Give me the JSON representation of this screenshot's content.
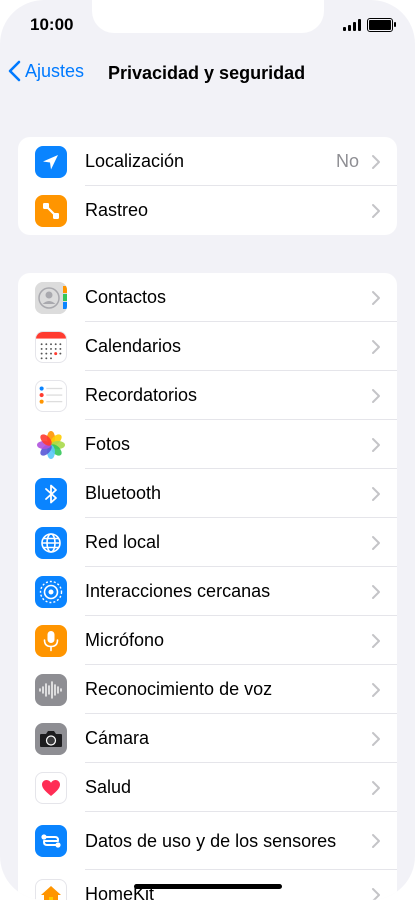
{
  "status_bar": {
    "time": "10:00"
  },
  "nav": {
    "back_label": "Ajustes",
    "title": "Privacidad y seguridad"
  },
  "group1": [
    {
      "name": "localizacion",
      "label": "Localización",
      "value": "No",
      "icon": "location-arrow-icon",
      "color": "#0a84ff"
    },
    {
      "name": "rastreo",
      "label": "Rastreo",
      "value": "",
      "icon": "tracking-icon",
      "color": "#ff9500"
    }
  ],
  "group2": [
    {
      "name": "contactos",
      "label": "Contactos",
      "icon": "contacts-icon"
    },
    {
      "name": "calendarios",
      "label": "Calendarios",
      "icon": "calendar-icon"
    },
    {
      "name": "recordatorios",
      "label": "Recordatorios",
      "icon": "reminders-icon"
    },
    {
      "name": "fotos",
      "label": "Fotos",
      "icon": "photos-icon"
    },
    {
      "name": "bluetooth",
      "label": "Bluetooth",
      "icon": "bluetooth-icon",
      "color": "#0a84ff"
    },
    {
      "name": "red-local",
      "label": "Red local",
      "icon": "globe-icon",
      "color": "#0a84ff"
    },
    {
      "name": "interacciones-cercanas",
      "label": "Interacciones cercanas",
      "icon": "nearby-interactions-icon",
      "color": "#0a84ff"
    },
    {
      "name": "microfono",
      "label": "Micrófono",
      "icon": "microphone-icon",
      "color": "#ff9500"
    },
    {
      "name": "reconocimiento-de-voz",
      "label": "Reconocimiento de voz",
      "icon": "waveform-icon",
      "color": "#8e8e93"
    },
    {
      "name": "camara",
      "label": "Cámara",
      "icon": "camera-icon",
      "color": "#8e8e93"
    },
    {
      "name": "salud",
      "label": "Salud",
      "icon": "heart-icon"
    },
    {
      "name": "datos-de-uso",
      "label": "Datos de uso y de los sensores",
      "icon": "sensor-data-icon",
      "color": "#0a84ff"
    },
    {
      "name": "homekit",
      "label": "HomeKit",
      "icon": "home-icon"
    }
  ]
}
